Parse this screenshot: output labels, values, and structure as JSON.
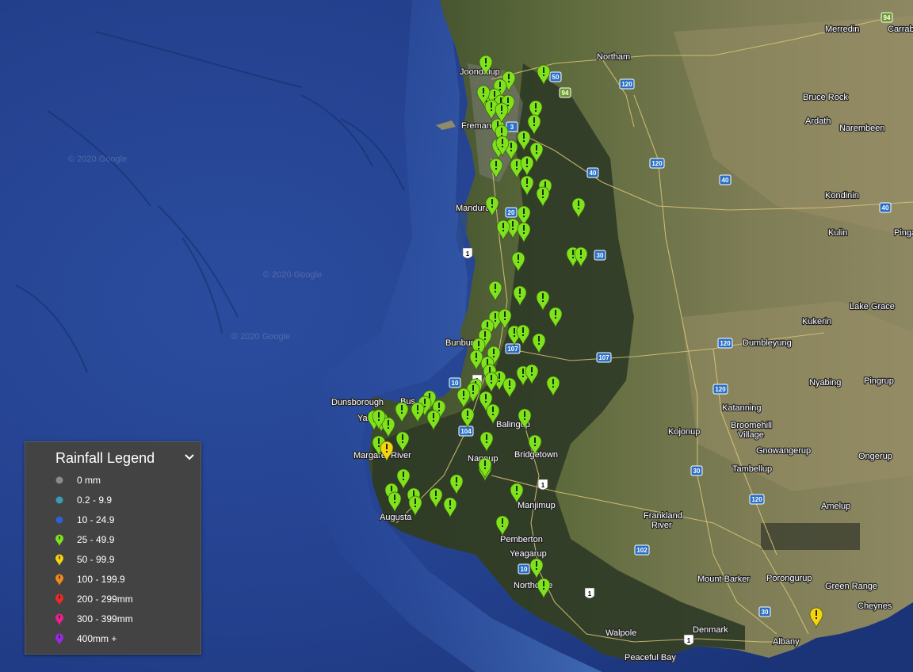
{
  "map": {
    "watermark": "© 2020 Google",
    "places": [
      {
        "id": "merredin",
        "name": "Merredin"
      },
      {
        "id": "carrabin",
        "name": "Carrab"
      },
      {
        "id": "joondalup",
        "name": "Joondalup"
      },
      {
        "id": "northam",
        "name": "Northam"
      },
      {
        "id": "fremantle",
        "name": "Fremantle"
      },
      {
        "id": "bruce-rock",
        "name": "Bruce Rock"
      },
      {
        "id": "ardath",
        "name": "Ardath"
      },
      {
        "id": "narembeen",
        "name": "Narembeen"
      },
      {
        "id": "kondinin",
        "name": "Kondinin"
      },
      {
        "id": "mandurah",
        "name": "Mandurah"
      },
      {
        "id": "kulin",
        "name": "Kulin"
      },
      {
        "id": "pingaring",
        "name": "Pinga"
      },
      {
        "id": "lake-grace",
        "name": "Lake Grace"
      },
      {
        "id": "kukerin",
        "name": "Kukerin"
      },
      {
        "id": "dumbleyung",
        "name": "Dumbleyung"
      },
      {
        "id": "bunbury",
        "name": "Bunbury"
      },
      {
        "id": "nyabing",
        "name": "Nyabing"
      },
      {
        "id": "pingrup",
        "name": "Pingrup"
      },
      {
        "id": "dunsborough",
        "name": "Dunsborough"
      },
      {
        "id": "busselton",
        "name": "Bus"
      },
      {
        "id": "yallingup",
        "name": "Yal"
      },
      {
        "id": "balingup",
        "name": "Balingup"
      },
      {
        "id": "katanning",
        "name": "Katanning"
      },
      {
        "id": "broomehill",
        "name": "Broomehill Village"
      },
      {
        "id": "kojonup",
        "name": "Kojonup"
      },
      {
        "id": "margaret-river",
        "name": "Margaret River"
      },
      {
        "id": "nannup",
        "name": "Nannup"
      },
      {
        "id": "bridgetown",
        "name": "Bridgetown"
      },
      {
        "id": "gnowangerup",
        "name": "Gnowangerup"
      },
      {
        "id": "ongerup",
        "name": "Ongerup"
      },
      {
        "id": "tambellup",
        "name": "Tambellup"
      },
      {
        "id": "manjimup",
        "name": "Manjimup"
      },
      {
        "id": "amelup",
        "name": "Amelup"
      },
      {
        "id": "augusta",
        "name": "Augusta"
      },
      {
        "id": "frankland",
        "name": "Frankland River"
      },
      {
        "id": "pemberton",
        "name": "Pemberton"
      },
      {
        "id": "yeagarup",
        "name": "Yeagarup"
      },
      {
        "id": "mount-barker",
        "name": "Mount Barker"
      },
      {
        "id": "porongurup",
        "name": "Porongurup"
      },
      {
        "id": "green-range",
        "name": "Green Range"
      },
      {
        "id": "northcliffe",
        "name": "Northcliffe"
      },
      {
        "id": "cheynes",
        "name": "Cheynes"
      },
      {
        "id": "walpole",
        "name": "Walpole"
      },
      {
        "id": "denmark",
        "name": "Denmark"
      },
      {
        "id": "albany",
        "name": "Albany"
      },
      {
        "id": "peaceful-bay",
        "name": "Peaceful Bay"
      }
    ],
    "shields": [
      "94",
      "50",
      "94",
      "120",
      "3",
      "120",
      "40",
      "40",
      "40",
      "20",
      "30",
      "1",
      "107",
      "107",
      "120",
      "10",
      "1",
      "104",
      "120",
      "30",
      "1",
      "120",
      "102",
      "10",
      "1",
      "30",
      "1"
    ]
  },
  "legend": {
    "title": "Rainfall Legend",
    "toggle_icon": "chevron-down-icon",
    "items": [
      {
        "label": "0 mm",
        "icon": "dot",
        "color": "#8a8a8a"
      },
      {
        "label": "0.2 - 9.9",
        "icon": "dot",
        "color": "#3a9bb5"
      },
      {
        "label": "10 - 24.9",
        "icon": "dot",
        "color": "#2e5fd6"
      },
      {
        "label": "25 - 49.9",
        "icon": "pin",
        "color": "#7ee31d"
      },
      {
        "label": "50 - 99.9",
        "icon": "pin",
        "color": "#f6d20f"
      },
      {
        "label": "100 - 199.9",
        "icon": "pin",
        "color": "#f28a1b"
      },
      {
        "label": "200 - 299mm",
        "icon": "pin",
        "color": "#ee2a24"
      },
      {
        "label": "300 - 399mm",
        "icon": "pin",
        "color": "#ee1f8e"
      },
      {
        "label": "400mm +",
        "icon": "pin",
        "color": "#9b27e6"
      }
    ]
  },
  "markers": {
    "green_count": 92,
    "yellow_count": 2,
    "green_color": "#7ee31d",
    "yellow_color": "#f6d20f"
  }
}
